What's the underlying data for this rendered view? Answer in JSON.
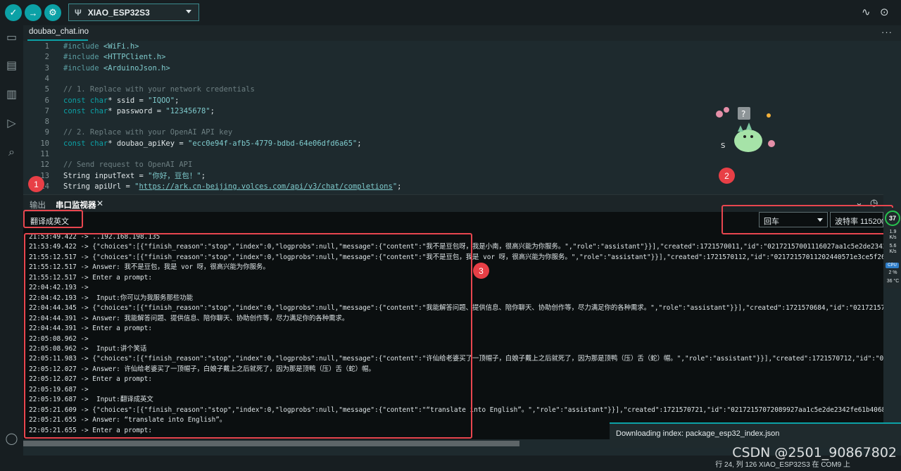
{
  "toolbar": {
    "board": "XIAO_ESP32S3",
    "verify_icon": "check-icon",
    "upload_icon": "arrow-right-icon",
    "debug_icon": "debug-icon"
  },
  "editor": {
    "tab": "doubao_chat.ino",
    "more": "···",
    "lines": [
      {
        "n": "1",
        "parts": [
          [
            "pp",
            "#include "
          ],
          [
            "str",
            "<WiFi.h>"
          ]
        ]
      },
      {
        "n": "2",
        "parts": [
          [
            "pp",
            "#include "
          ],
          [
            "str",
            "<HTTPClient.h>"
          ]
        ]
      },
      {
        "n": "3",
        "parts": [
          [
            "pp",
            "#include "
          ],
          [
            "str",
            "<ArduinoJson.h>"
          ]
        ]
      },
      {
        "n": "4",
        "parts": []
      },
      {
        "n": "5",
        "parts": [
          [
            "cmt",
            "// 1. Replace with your network credentials"
          ]
        ]
      },
      {
        "n": "6",
        "parts": [
          [
            "kw",
            "const char"
          ],
          [
            "txt",
            "* ssid = "
          ],
          [
            "str",
            "\"IQOO\""
          ],
          [
            "txt",
            ";"
          ]
        ]
      },
      {
        "n": "7",
        "parts": [
          [
            "kw",
            "const char"
          ],
          [
            "txt",
            "* password = "
          ],
          [
            "str",
            "\"12345678\""
          ],
          [
            "txt",
            ";"
          ]
        ]
      },
      {
        "n": "8",
        "parts": []
      },
      {
        "n": "9",
        "parts": [
          [
            "cmt",
            "// 2. Replace with your OpenAI API key"
          ]
        ]
      },
      {
        "n": "10",
        "parts": [
          [
            "kw",
            "const char"
          ],
          [
            "txt",
            "* doubao_apiKey = "
          ],
          [
            "str",
            "\"ecc0e94f-afb5-4779-bdbd-64e06dfd6a65\""
          ],
          [
            "txt",
            ";"
          ]
        ]
      },
      {
        "n": "11",
        "parts": []
      },
      {
        "n": "12",
        "parts": [
          [
            "cmt",
            "// Send request to OpenAI API"
          ]
        ]
      },
      {
        "n": "13",
        "parts": [
          [
            "txt",
            "String inputText = "
          ],
          [
            "str",
            "\"你好，豆包！\""
          ],
          [
            "txt",
            ";"
          ]
        ]
      },
      {
        "n": "14",
        "parts": [
          [
            "txt",
            "String apiUrl = "
          ],
          [
            "str",
            "\""
          ],
          [
            "url",
            "https://ark.cn-beijing.volces.com/api/v3/chat/completions"
          ],
          [
            "str",
            "\""
          ],
          [
            "txt",
            ";"
          ]
        ]
      }
    ]
  },
  "panel": {
    "tab_output": "输出",
    "tab_serial": "串口监视器",
    "message_input": "翻译成英文",
    "line_ending": "回车",
    "baud": "波特率 115200",
    "lines": [
      "21:53:49.422 -> ..192.168.198.135",
      "21:53:49.422 -> {\"choices\":[{\"finish_reason\":\"stop\",\"index\":0,\"logprobs\":null,\"message\":{\"content\":\"我不是豆包呀，我是小南，很高兴能为你服务。\",\"role\":\"assistant\"}}],\"created\":1721570011,\"id\":\"02172157001116027aa1c5e2de2342fe61",
      "21:55:12.517 -> {\"choices\":[{\"finish_reason\":\"stop\",\"index\":0,\"logprobs\":null,\"message\":{\"content\":\"我不是豆包，我是 vor 呀，很高兴能为你服务。\",\"role\":\"assistant\"}}],\"created\":1721570112,\"id\":\"02172157011202440571e3ce5f26177b3",
      "21:55:12.517 -> Answer: 我不是豆包，我是 vor 呀，很高兴能为你服务。",
      "21:55:12.517 -> Enter a prompt:",
      "22:04:42.193 ->",
      "22:04:42.193 ->  Input:你可以为我服务那些功能",
      "22:04:44.345 -> {\"choices\":[{\"finish_reason\":\"stop\",\"index\":0,\"logprobs\":null,\"message\":{\"content\":\"我能解答问题、提供信息、陪你聊天、协助创作等，尽力满足你的各种需求。\",\"role\":\"assistant\"}}],\"created\":1721570684,\"id\":\"02172157068",
      "22:04:44.391 -> Answer: 我能解答问题、提供信息、陪你聊天、协助创作等，尽力满足你的各种需求。",
      "22:04:44.391 -> Enter a prompt:",
      "22:05:08.962 ->",
      "22:05:08.962 ->  Input:讲个笑话",
      "22:05:11.983 -> {\"choices\":[{\"finish_reason\":\"stop\",\"index\":0,\"logprobs\":null,\"message\":{\"content\":\"许仙给老婆买了一顶帽子，白娘子戴上之后就死了，因为那是顶鸭（压）舌（蛇）帽。\",\"role\":\"assistant\"}}],\"created\":1721570712,\"id\":\"02172",
      "22:05:12.027 -> Answer: 许仙给老婆买了一顶帽子，白娘子戴上之后就死了，因为那是顶鸭（压）舌（蛇）帽。",
      "22:05:12.027 -> Enter a prompt:",
      "22:05:19.687 ->",
      "22:05:19.687 ->  Input:翻译成英文",
      "22:05:21.609 -> {\"choices\":[{\"finish_reason\":\"stop\",\"index\":0,\"logprobs\":null,\"message\":{\"content\":\"“translate into English”。\",\"role\":\"assistant\"}}],\"created\":1721570721,\"id\":\"02172157072089927aa1c5e2de2342fe61b406861efc757e235b0",
      "22:05:21.655 -> Answer: “translate into English”。",
      "22:05:21.655 -> Enter a prompt:"
    ]
  },
  "badges": [
    "1",
    "2",
    "3"
  ],
  "toast": "Downloading index: package_esp32_index.json",
  "status": "行 24, 列 126    XIAO_ESP32S3 在 COM9 上",
  "watermark": "CSDN @2501_90867802",
  "sys": {
    "score": "37",
    "up": "1.9\nK/s",
    "down": "5.6\nK/s",
    "cpu": "CPU",
    "cpu_pct": "2 %",
    "temp": "36 °C"
  }
}
